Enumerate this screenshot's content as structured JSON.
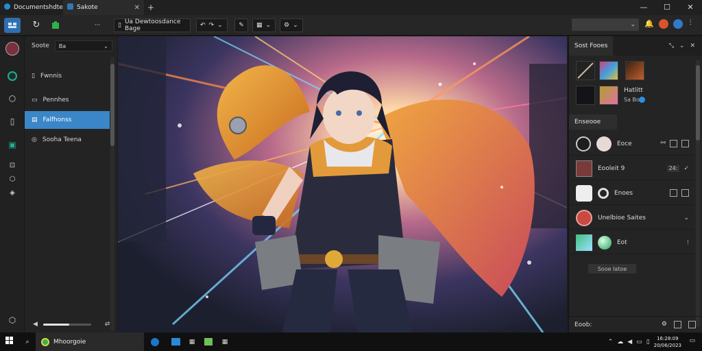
{
  "window": {
    "tabs": [
      {
        "label": "Documentshdte",
        "active": false
      },
      {
        "label": "Sakote",
        "active": true
      }
    ],
    "controls": [
      "minimize",
      "maximize",
      "close"
    ]
  },
  "toolbar": {
    "file_label": "Ua Dewtoosdance Bage",
    "zoom_label": "ℭ",
    "search_placeholder": ""
  },
  "left_panel": {
    "header_label": "Soote",
    "select_value": "Ba",
    "items": [
      {
        "label": "Fwnnis",
        "active": false
      },
      {
        "label": "Pennhes",
        "active": false
      },
      {
        "label": "Falfhonss",
        "active": true
      },
      {
        "label": "Sooha Teena",
        "active": false
      }
    ],
    "slider_value": 0.55
  },
  "right_panel": {
    "tab_label": "Sost Fooes",
    "thumb_label": "Hatlitt",
    "thumb_sub": "Sa Bo",
    "section_label": "Enseooe",
    "layers": [
      {
        "name": "Eoce",
        "extra": ""
      },
      {
        "name": "Eooleit 9",
        "extra": "24:"
      },
      {
        "name": "Enoes",
        "extra": ""
      },
      {
        "name": "Unelbioe Saites",
        "extra": ""
      },
      {
        "name": "Eot",
        "extra": ""
      }
    ],
    "button_label": "Sooe Iatoe",
    "footer_label": "Eoob:"
  },
  "taskbar": {
    "app_label": "Mhoorgoie",
    "clock_time": "16:28:09",
    "clock_date": "20/06/2023"
  },
  "colors": {
    "accent": "#3a86c8",
    "bg": "#1b1b1b",
    "panel": "#242424"
  }
}
